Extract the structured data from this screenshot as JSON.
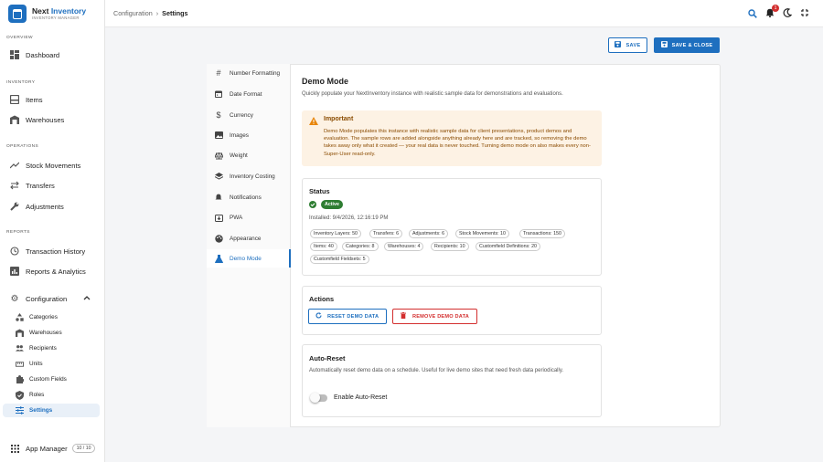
{
  "brand": {
    "name_part1": "Next",
    "name_part2": "Inventory",
    "subtitle": "INVENTORY MANAGER"
  },
  "sidebar": {
    "sections": {
      "overview": "OVERVIEW",
      "inventory": "INVENTORY",
      "operations": "OPERATIONS",
      "reports": "REPORTS"
    },
    "items": [
      {
        "label": "Dashboard",
        "icon": "dashboard-icon"
      },
      {
        "label": "Items",
        "icon": "inbox-icon"
      },
      {
        "label": "Warehouses",
        "icon": "warehouse-icon"
      },
      {
        "label": "Stock Movements",
        "icon": "trending-icon"
      },
      {
        "label": "Transfers",
        "icon": "swap-icon"
      },
      {
        "label": "Adjustments",
        "icon": "wrench-icon"
      },
      {
        "label": "Transaction History",
        "icon": "history-icon"
      },
      {
        "label": "Reports & Analytics",
        "icon": "chart-icon"
      },
      {
        "label": "Configuration",
        "icon": "gear-icon"
      }
    ],
    "config_items": [
      {
        "label": "Categories",
        "icon": "category-icon"
      },
      {
        "label": "Warehouses",
        "icon": "warehouse-icon"
      },
      {
        "label": "Recipients",
        "icon": "people-icon"
      },
      {
        "label": "Units",
        "icon": "ruler-icon"
      },
      {
        "label": "Custom Fields",
        "icon": "puzzle-icon"
      },
      {
        "label": "Roles",
        "icon": "shield-icon"
      },
      {
        "label": "Settings",
        "icon": "tune-icon"
      }
    ],
    "app_manager": {
      "label": "App Manager",
      "count": "10 / 10"
    }
  },
  "header": {
    "breadcrumb_parent": "Configuration",
    "breadcrumb_sep": "›",
    "breadcrumb_current": "Settings",
    "notification_count": "1"
  },
  "toolbar": {
    "save_label": "SAVE",
    "save_close_label": "SAVE & CLOSE"
  },
  "tabs": [
    {
      "label": "Number Formatting",
      "icon": "hash-icon"
    },
    {
      "label": "Date Format",
      "icon": "calendar-icon"
    },
    {
      "label": "Currency",
      "icon": "dollar-icon"
    },
    {
      "label": "Images",
      "icon": "image-icon"
    },
    {
      "label": "Weight",
      "icon": "scale-icon"
    },
    {
      "label": "Inventory Costing",
      "icon": "layers-icon"
    },
    {
      "label": "Notifications",
      "icon": "bell-icon"
    },
    {
      "label": "PWA",
      "icon": "install-icon"
    },
    {
      "label": "Appearance",
      "icon": "palette-icon"
    },
    {
      "label": "Demo Mode",
      "icon": "flask-icon"
    }
  ],
  "demo": {
    "title": "Demo Mode",
    "description": "Quickly populate your NextInventory instance with realistic sample data for demonstrations and evaluations.",
    "alert_title": "Important",
    "alert_body": "Demo Mode populates this instance with realistic sample data for client presentations, product demos and evaluation. The sample rows are added alongside anything already here and are tracked, so removing the demo takes away only what it created — your real data is never touched. Turning demo mode on also makes every non-Super-User read-only.",
    "status_title": "Status",
    "status_badge": "Active",
    "installed": "Installed: 9/4/2026, 12:16:19 PM",
    "chips": [
      "Inventory Layers: 50",
      "Transfers: 6",
      "Adjustments: 6",
      "Stock Movements: 10",
      "Transactions: 150",
      "Items: 40",
      "Categories: 8",
      "Warehouses: 4",
      "Recipients: 10",
      "Customfield Definitions: 20",
      "Customfield Fieldsets: 5"
    ],
    "actions_title": "Actions",
    "reset_label": "RESET DEMO DATA",
    "remove_label": "REMOVE DEMO DATA",
    "autoreset_title": "Auto-Reset",
    "autoreset_desc": "Automatically reset demo data on a schedule. Useful for live demo sites that need fresh data periodically.",
    "autoreset_toggle_label": "Enable Auto-Reset",
    "autoreset_enabled": false
  },
  "colors": {
    "primary": "#1e6fbf",
    "success": "#2e7d32",
    "danger": "#d32f2f",
    "warning": "#e8860c",
    "alert_bg": "#fdf2e4"
  }
}
